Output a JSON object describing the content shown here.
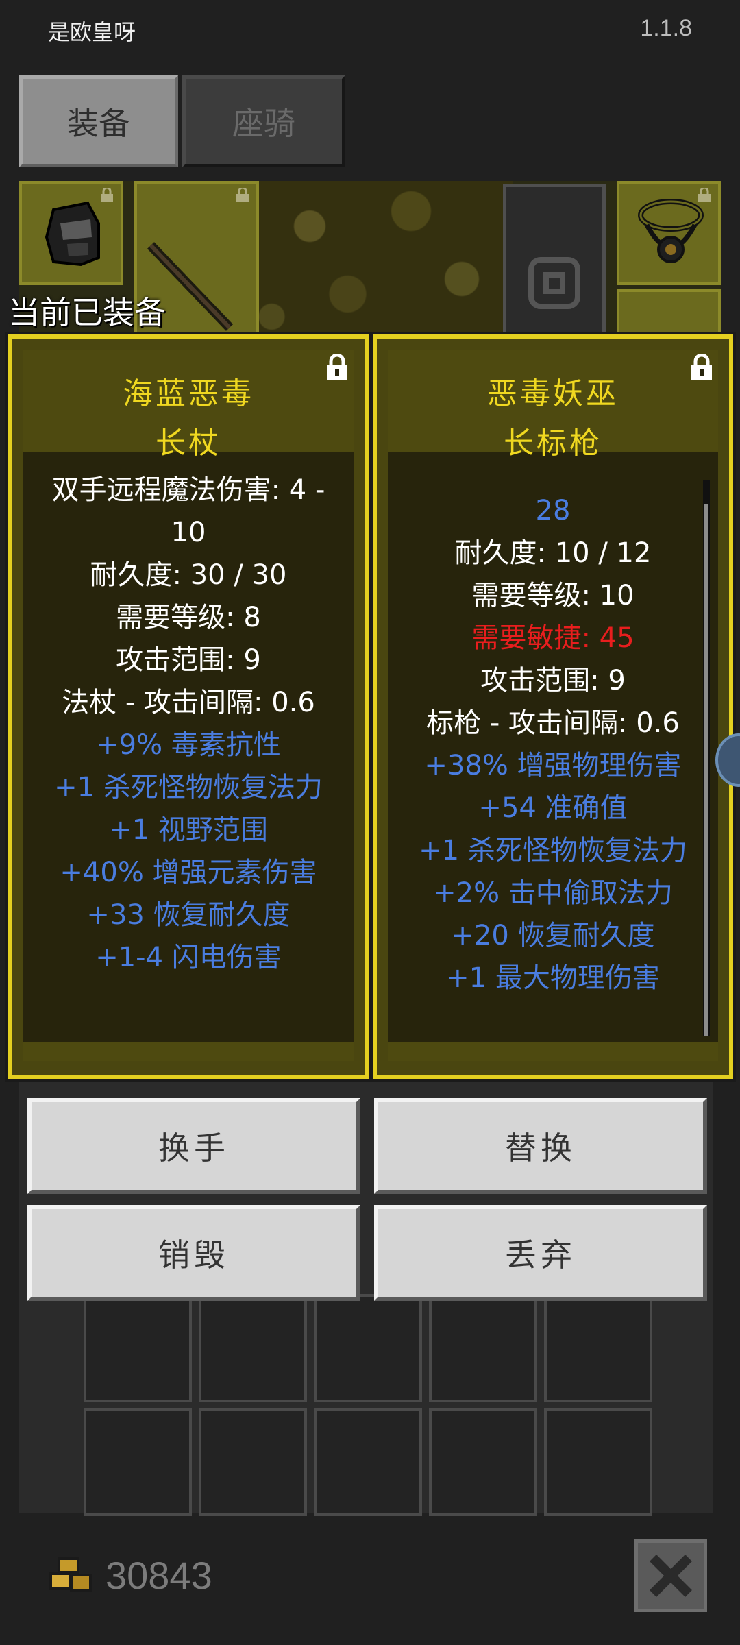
{
  "header": {
    "player_name": "是欧皇呀",
    "version": "1.1.8"
  },
  "tabs": [
    {
      "label": "装备",
      "selected": true
    },
    {
      "label": "座骑",
      "selected": false
    }
  ],
  "equipped_label": "当前已装备",
  "cards": [
    {
      "title_line1": "海蓝恶毒",
      "title_line2": "长杖",
      "locked": true,
      "stats": [
        {
          "text": "双手远程魔法伤害: 4 -",
          "color": "white"
        },
        {
          "text": "10",
          "color": "white"
        },
        {
          "text": "耐久度: 30 / 30",
          "color": "white"
        },
        {
          "text": "需要等级: 8",
          "color": "white"
        },
        {
          "text": "攻击范围: 9",
          "color": "white"
        },
        {
          "text": "法杖 - 攻击间隔: 0.6",
          "color": "white"
        },
        {
          "text": "+9% 毒素抗性",
          "color": "blue"
        },
        {
          "text": "+1 杀死怪物恢复法力",
          "color": "blue"
        },
        {
          "text": "+1 视野范围",
          "color": "blue"
        },
        {
          "text": "+40% 增强元素伤害",
          "color": "blue"
        },
        {
          "text": "+33 恢复耐久度",
          "color": "blue"
        },
        {
          "text": "+1-4 闪电伤害",
          "color": "blue"
        }
      ]
    },
    {
      "title_line1": "恶毒妖巫",
      "title_line2": "长标枪",
      "locked": true,
      "stats": [
        {
          "text": "28",
          "color": "blue"
        },
        {
          "text": "耐久度: 10 / 12",
          "color": "white"
        },
        {
          "text": "需要等级: 10",
          "color": "white"
        },
        {
          "text": "需要敏捷: 45",
          "color": "red"
        },
        {
          "text": "攻击范围: 9",
          "color": "white"
        },
        {
          "text": "标枪 - 攻击间隔: 0.6",
          "color": "white"
        },
        {
          "text": "+38% 增强物理伤害",
          "color": "blue"
        },
        {
          "text": "+54 准确值",
          "color": "blue"
        },
        {
          "text": "+1 杀死怪物恢复法力",
          "color": "blue"
        },
        {
          "text": "+2% 击中偷取法力",
          "color": "blue"
        },
        {
          "text": "+20 恢复耐久度",
          "color": "blue"
        },
        {
          "text": "+1 最大物理伤害",
          "color": "blue"
        }
      ]
    }
  ],
  "actions": {
    "swap_hand": "换手",
    "replace": "替换",
    "destroy": "销毁",
    "discard": "丢弃"
  },
  "footer": {
    "gold": "30843",
    "gold_icon": "gold-coins-icon",
    "close_icon": "close-icon"
  },
  "colors": {
    "accent_yellow": "#e4d020",
    "stat_blue": "#4a7de0",
    "stat_red": "#e81e1e"
  }
}
